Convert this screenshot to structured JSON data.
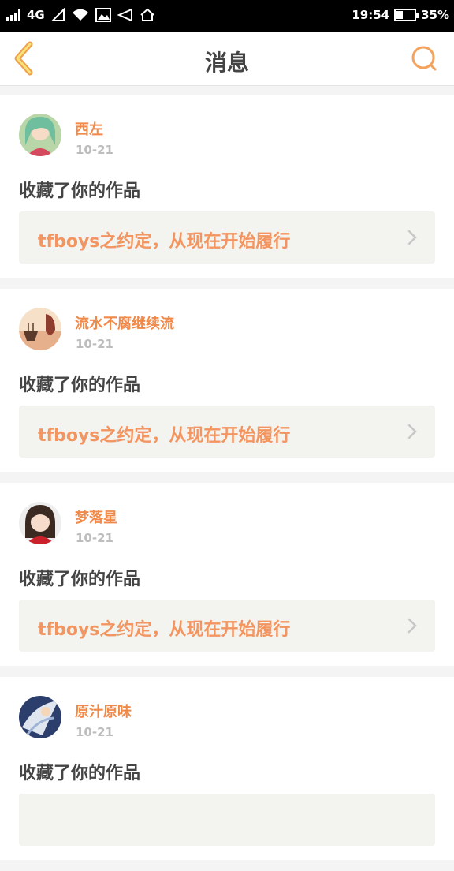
{
  "status_bar": {
    "network": "4G",
    "time": "19:54",
    "battery": "35%",
    "battery_level": 0.35
  },
  "header": {
    "title": "消息",
    "back_icon": "chevron-left-icon",
    "search_icon": "search-icon",
    "accent_color": "#f0a04b"
  },
  "messages": [
    {
      "user": "西左",
      "date": "10-21",
      "action": "收藏了你的作品",
      "work": "tfboys之约定，从现在开始履行"
    },
    {
      "user": "流水不腐继续流",
      "date": "10-21",
      "action": "收藏了你的作品",
      "work": "tfboys之约定，从现在开始履行"
    },
    {
      "user": "梦落星",
      "date": "10-21",
      "action": "收藏了你的作品",
      "work": "tfboys之约定，从现在开始履行"
    },
    {
      "user": "原汁原味",
      "date": "10-21",
      "action": "收藏了你的作品",
      "work": ""
    }
  ]
}
